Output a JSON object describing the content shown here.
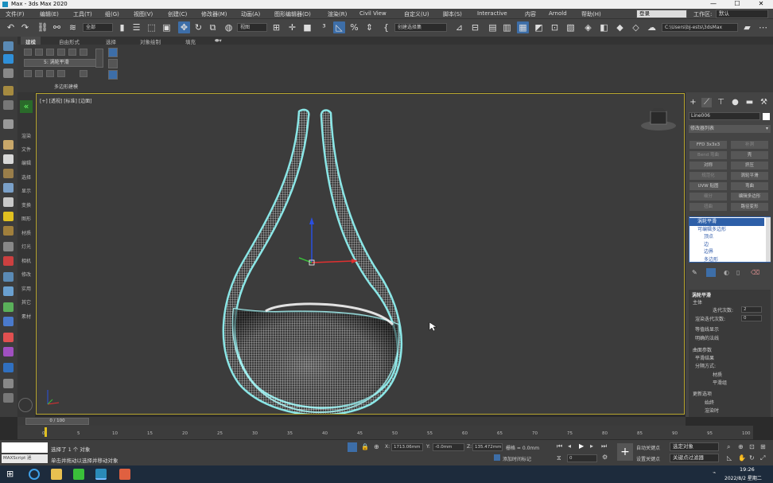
{
  "window": {
    "title": "Max - 3ds Max 2020",
    "controls": [
      "—",
      "☐",
      "✕"
    ]
  },
  "menu": {
    "items": [
      "文件(F)",
      "编辑(E)",
      "工具(T)",
      "组(G)",
      "视图(V)",
      "创建(C)",
      "修改器(M)",
      "动画(A)",
      "图形编辑器(D)",
      "渲染(R)",
      "Civil View",
      "自定义(U)",
      "脚本(S)",
      "Interactive",
      "内容",
      "Arnold",
      "帮助(H)"
    ],
    "user_dropdown": "登录",
    "workspace_label": "工作区:",
    "workspace_value": "默认"
  },
  "toolbar": {
    "selection_filter": "全部",
    "view_dropdown": "视图",
    "named_selection": "创建选择集",
    "path": "C:\\Users\\bJ-ests\\3dsMax"
  },
  "ribbon": {
    "tabs": [
      "建模",
      "自由形式",
      "选择",
      "对象绘制",
      "填充"
    ],
    "active_tab": "建模",
    "panel_label": "多边形建模",
    "sub_label": "5: 涡轮平滑"
  },
  "side_commands": [
    "渲染",
    "文件",
    "编辑",
    "选择",
    "显示",
    "变换",
    "图形",
    "材质",
    "灯光",
    "相机",
    "修改",
    "实用",
    "其它",
    "素材"
  ],
  "viewport": {
    "label": "[+] [透视] [标准] [边面]"
  },
  "command_panel": {
    "object_name": "Line006",
    "modifier_list": "修改器列表",
    "buttons": [
      {
        "label": "FFD 3x3x3",
        "dim": false
      },
      {
        "label": "补洞",
        "dim": true
      },
      {
        "label": "Bend 弯曲",
        "dim": true
      },
      {
        "label": "壳",
        "dim": false
      },
      {
        "label": "对称",
        "dim": false
      },
      {
        "label": "挤压",
        "dim": false
      },
      {
        "label": "规范化",
        "dim": true
      },
      {
        "label": "涡轮平滑",
        "dim": false
      },
      {
        "label": "UVW 贴图",
        "dim": false
      },
      {
        "label": "弯曲",
        "dim": false
      },
      {
        "label": "细分",
        "dim": true
      },
      {
        "label": "编辑多边形",
        "dim": false
      },
      {
        "label": "扭曲",
        "dim": true
      },
      {
        "label": "路径变形",
        "dim": false
      }
    ],
    "stack": [
      {
        "label": "涡轮平滑",
        "selected": true
      },
      {
        "label": "可编辑多边形",
        "selected": false
      },
      {
        "label": "顶点",
        "selected": false
      },
      {
        "label": "边",
        "selected": false
      },
      {
        "label": "边界",
        "selected": false
      },
      {
        "label": "多边形",
        "selected": false
      }
    ],
    "rollout_title": "涡轮平滑",
    "main_label": "主体",
    "iterations_label": "迭代次数:",
    "iterations_value": "2",
    "render_iters_label": "渲染迭代次数:",
    "render_iters_value": "0",
    "isoline_label": "等值线显示",
    "explicit_normals_label": "明确的法线",
    "surface_params_label": "曲面参数",
    "smooth_result_label": "平滑结果",
    "separate_by_label": "分隔方式:",
    "materials_label": "材质",
    "smoothing_groups_label": "平滑组",
    "update_label": "更新选项",
    "always_label": "始终",
    "when_rendering_label": "渲染时"
  },
  "timeline": {
    "frame_display": "0 / 100",
    "ticks": [
      "0",
      "5",
      "10",
      "15",
      "20",
      "25",
      "30",
      "35",
      "40",
      "45",
      "50",
      "55",
      "60",
      "65",
      "70",
      "75",
      "80",
      "85",
      "90",
      "95",
      "100"
    ]
  },
  "status": {
    "maxscript": "MAXScript 迷",
    "selected": "选择了 1 个 对象",
    "hint": "单击并拖动以选择并移动对象",
    "x_value": "1713.06mm",
    "y_value": "-0.0mm",
    "z_value": "135.472mm",
    "grid_label": "栅格 = 0.0mm",
    "add_time_tag": "添加时间标记",
    "auto_key": "自动关键点",
    "set_key": "设置关键点",
    "selected_obj": "选定对象",
    "key_filters": "关键点过滤器",
    "frame_value": "0"
  },
  "taskbar": {
    "time": "19:26",
    "date": "2022/8/2 星期二"
  }
}
